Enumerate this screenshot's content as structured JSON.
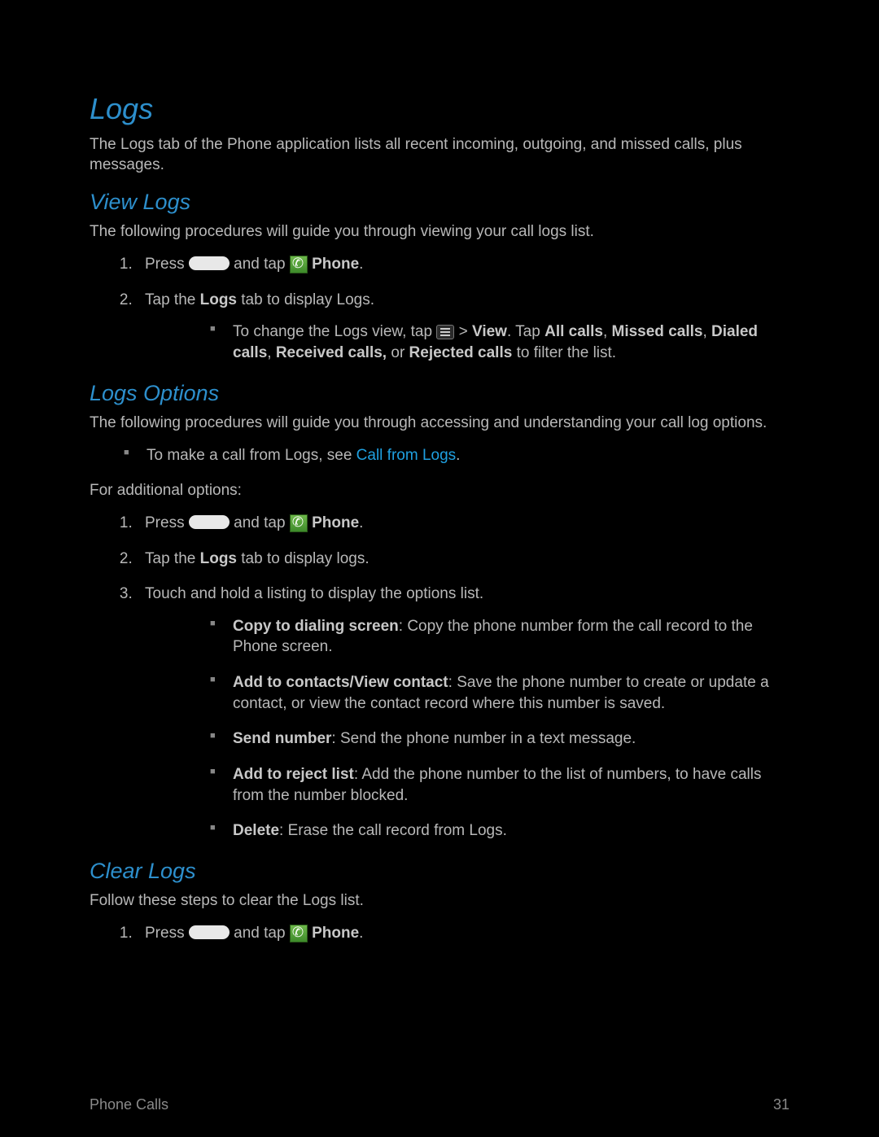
{
  "h1": "Logs",
  "intro": "The Logs tab of the Phone application lists all recent incoming, outgoing, and missed calls, plus messages.",
  "viewLogs": {
    "heading": "View Logs",
    "intro": "The following procedures will guide you through viewing your call logs list.",
    "step1_a": "Press ",
    "step1_b": " and tap ",
    "step1_c": " ",
    "phone_label": "Phone",
    "dot": ".",
    "step2_a": "Tap the ",
    "step2_logs": "Logs",
    "step2_b": " tab to display Logs.",
    "sub_a": "To change the Logs view, tap ",
    "gt": " > ",
    "view": "View",
    "sub_b": ". Tap ",
    "allcalls": "All calls",
    "comma": ", ",
    "missed": "Missed calls",
    "dialed": "Dialed calls",
    "received": "Received calls,",
    "or": " or ",
    "rejected": "Rejected calls",
    "sub_c": " to filter the list."
  },
  "logsOptions": {
    "heading": "Logs Options",
    "intro": "The following procedures will guide you through accessing and understanding your call log options.",
    "bullet_a": "To make a call from Logs, see ",
    "link": "Call from Logs",
    "dot": ".",
    "addl": "For additional options:",
    "step1_a": "Press ",
    "step1_b": " and tap ",
    "phone_label": "Phone",
    "step2_a": "Tap the ",
    "step2_logs": "Logs",
    "step2_b": " tab to display logs.",
    "step3": "Touch and hold a listing to display the options list.",
    "opt1_b": "Copy to dialing screen",
    "opt1_t": ": Copy the phone number form the call record to the Phone screen.",
    "opt2_b": "Add to contacts/View contact",
    "opt2_t": ": Save the phone number to create or update a contact, or view the contact record where this number is saved.",
    "opt3_b": "Send number",
    "opt3_t": ": Send the phone number in a text message.",
    "opt4_b": "Add to reject list",
    "opt4_t": ": Add the phone number to the list of numbers, to have calls from the number blocked.",
    "opt5_b": "Delete",
    "opt5_t": ": Erase the call record from Logs."
  },
  "clearLogs": {
    "heading": "Clear Logs",
    "intro": "Follow these steps to clear the Logs list.",
    "step1_a": "Press ",
    "step1_b": " and tap ",
    "phone_label": "Phone",
    "dot": "."
  },
  "footer": {
    "section": "Phone Calls",
    "page": "31"
  }
}
